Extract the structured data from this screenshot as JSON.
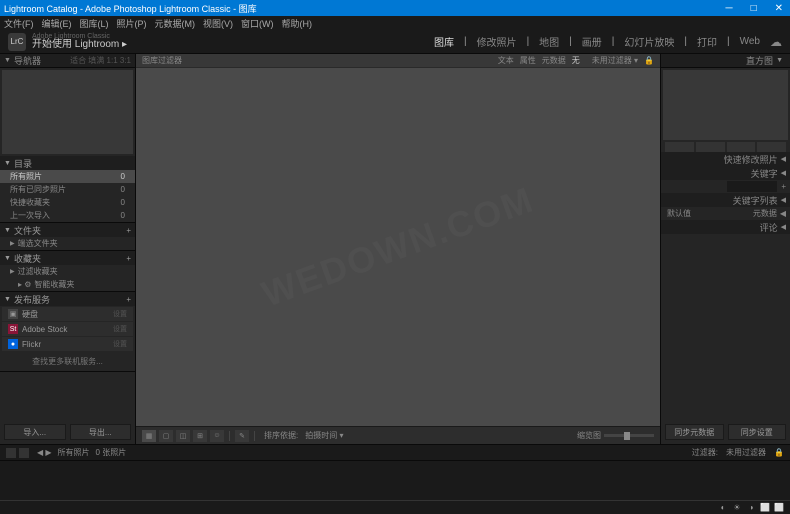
{
  "titlebar": {
    "text": "Lightroom Catalog - Adobe Photoshop Lightroom Classic - 图库"
  },
  "menubar": [
    "文件(F)",
    "编辑(E)",
    "图库(L)",
    "照片(P)",
    "元数据(M)",
    "视图(V)",
    "窗口(W)",
    "帮助(H)"
  ],
  "app": {
    "badge": "LrC",
    "small": "Adobe Lightroom Classic",
    "main": "开始使用 Lightroom ▸"
  },
  "modules": [
    {
      "label": "图库",
      "active": true
    },
    {
      "label": "修改照片",
      "active": false
    },
    {
      "label": "地图",
      "active": false
    },
    {
      "label": "画册",
      "active": false
    },
    {
      "label": "幻灯片放映",
      "active": false
    },
    {
      "label": "打印",
      "active": false
    },
    {
      "label": "Web",
      "active": false
    }
  ],
  "left": {
    "nav": {
      "title": "导航器",
      "extra": "适合 填满 1:1 3:1"
    },
    "catalog": {
      "title": "目录",
      "items": [
        {
          "label": "所有照片",
          "count": "0",
          "selected": true
        },
        {
          "label": "所有已同步照片",
          "count": "0"
        },
        {
          "label": "快捷收藏夹",
          "count": "0"
        },
        {
          "label": "上一次导入",
          "count": "0"
        }
      ]
    },
    "folders": {
      "title": "文件夹",
      "items": [
        {
          "label": "端选文件夹"
        }
      ]
    },
    "collections": {
      "title": "收藏夹",
      "items": [
        {
          "label": "过滤收藏夹",
          "arrow": true
        },
        {
          "label": "智能收藏夹",
          "icon": "📷"
        }
      ]
    },
    "publish": {
      "title": "发布服务",
      "items": [
        {
          "label": "硬盘",
          "icon": "💾"
        },
        {
          "label": "Adobe Stock",
          "icon": "St"
        },
        {
          "label": "Flickr",
          "icon": "Fl"
        }
      ],
      "find": "查找更多联机服务..."
    },
    "import": "导入...",
    "export": "导出..."
  },
  "center": {
    "filterLabel": "图库过滤器",
    "tabs": [
      {
        "label": "文本"
      },
      {
        "label": "属性"
      },
      {
        "label": "元数据"
      },
      {
        "label": "无",
        "active": true
      }
    ],
    "preset": "未用过滤器 ▾",
    "sort": "排序依据:",
    "sortVal": "拍摄时间 ▾",
    "thumb": "缩览图"
  },
  "right": {
    "histogram": "直方图",
    "quickdev": "快速修改照片",
    "keywords": "关键字",
    "keywordlist": "关键字列表",
    "metadata": "元数据",
    "metadataMode": "默认值",
    "comments": "评论",
    "sync": "同步元数据",
    "syncset": "同步设置"
  },
  "bottombar": {
    "path": "所有照片",
    "count": "0 张照片",
    "filter": "过滤器:",
    "preset": "未用过滤器"
  },
  "status": {
    "icons": [
      "◐",
      "☀",
      "◑",
      "⬜",
      "⬜"
    ]
  }
}
